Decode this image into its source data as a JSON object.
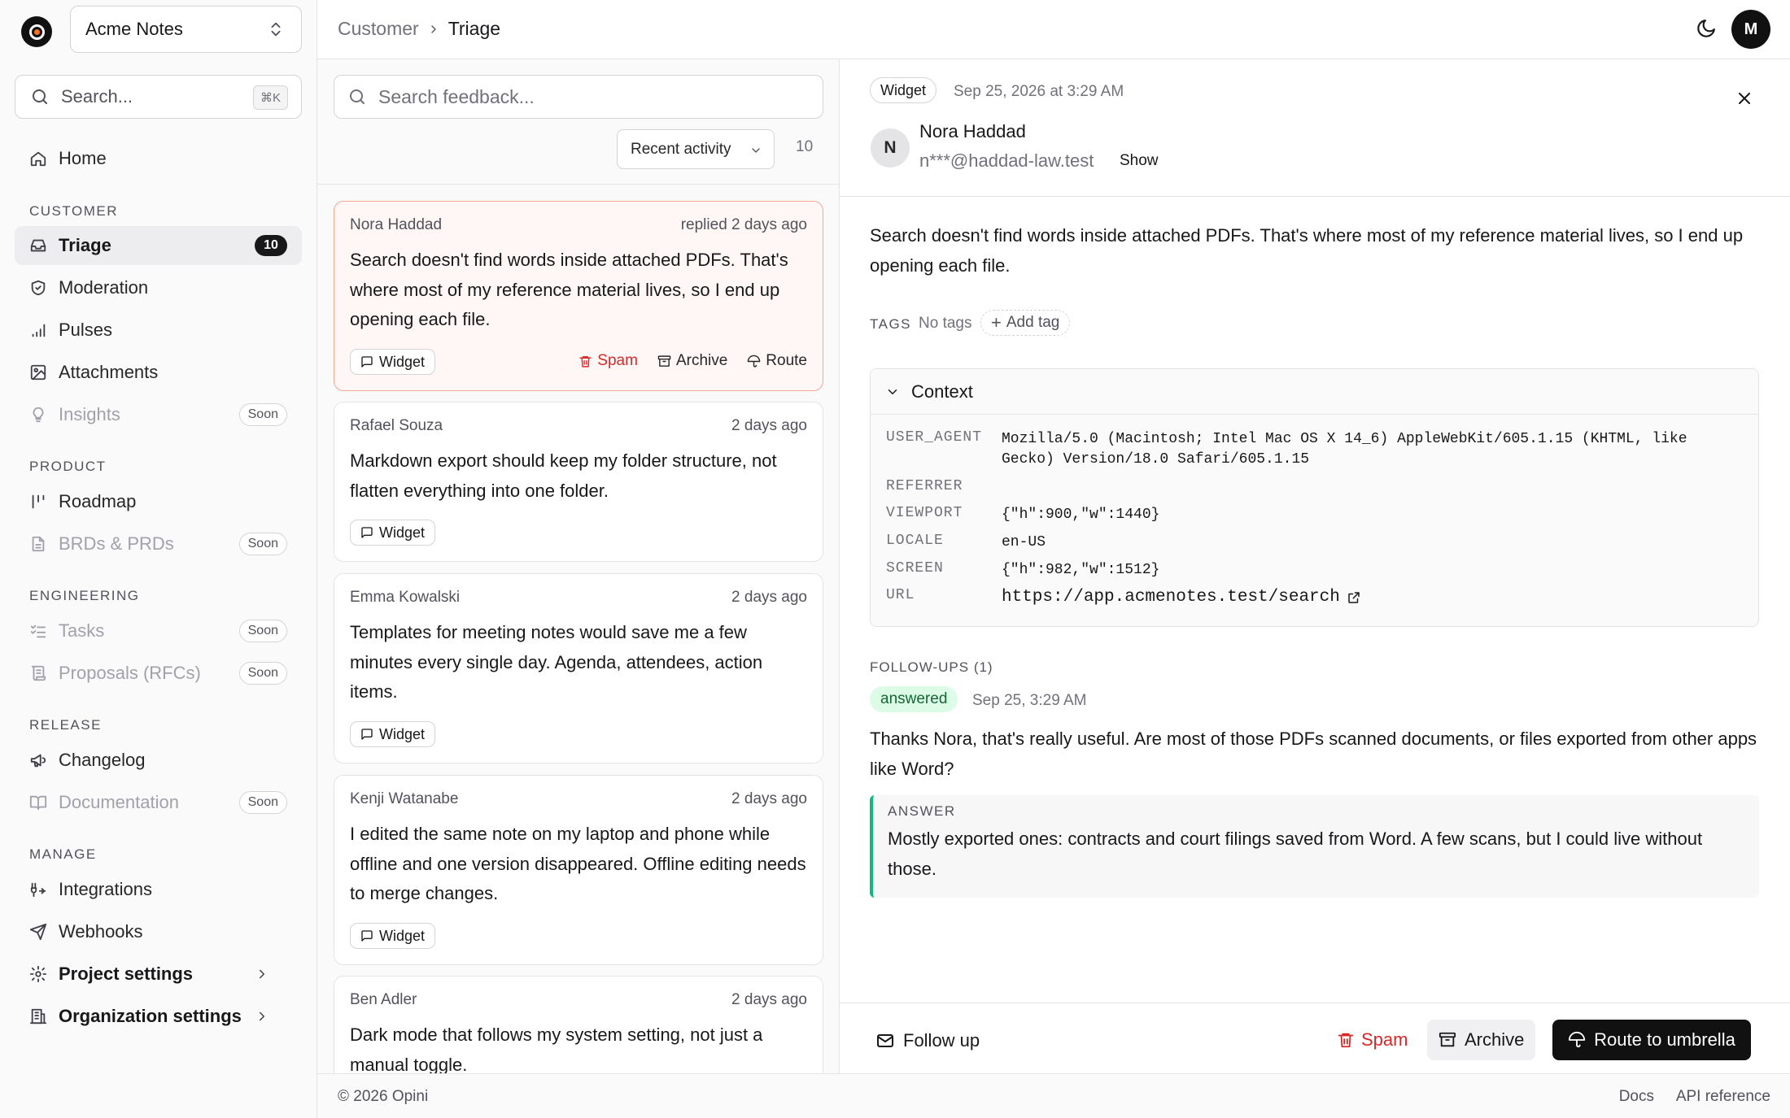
{
  "app": {
    "workspace": "Acme Notes"
  },
  "sidebar": {
    "search_placeholder": "Search...",
    "search_shortcut": "⌘K",
    "home": "Home",
    "sections": {
      "customer": "CUSTOMER",
      "product": "PRODUCT",
      "engineering": "ENGINEERING",
      "release": "RELEASE",
      "manage": "MANAGE"
    },
    "items": {
      "triage": {
        "label": "Triage",
        "count": "10"
      },
      "moderation": {
        "label": "Moderation"
      },
      "pulses": {
        "label": "Pulses"
      },
      "attachments": {
        "label": "Attachments"
      },
      "insights": {
        "label": "Insights",
        "badge": "Soon"
      },
      "roadmap": {
        "label": "Roadmap"
      },
      "brds": {
        "label": "BRDs & PRDs",
        "badge": "Soon"
      },
      "tasks": {
        "label": "Tasks",
        "badge": "Soon"
      },
      "proposals": {
        "label": "Proposals (RFCs)",
        "badge": "Soon"
      },
      "changelog": {
        "label": "Changelog"
      },
      "documentation": {
        "label": "Documentation",
        "badge": "Soon"
      },
      "integrations": {
        "label": "Integrations"
      },
      "webhooks": {
        "label": "Webhooks"
      },
      "project_settings": {
        "label": "Project settings"
      },
      "org_settings": {
        "label": "Organization settings"
      }
    }
  },
  "header": {
    "breadcrumb": [
      "Customer",
      "Triage"
    ],
    "avatar_initial": "M"
  },
  "list": {
    "search_placeholder": "Search feedback...",
    "sort": "Recent activity",
    "count": "10",
    "items": [
      {
        "author": "Nora Haddad",
        "time": "replied 2 days ago",
        "text": "Search doesn't find words inside attached PDFs. That's where most of my reference material lives, so I end up opening each file.",
        "source": "Widget",
        "actions": {
          "spam": "Spam",
          "archive": "Archive",
          "route": "Route"
        }
      },
      {
        "author": "Rafael Souza",
        "time": "2 days ago",
        "text": "Markdown export should keep my folder structure, not flatten everything into one folder.",
        "source": "Widget"
      },
      {
        "author": "Emma Kowalski",
        "time": "2 days ago",
        "text": "Templates for meeting notes would save me a few minutes every single day. Agenda, attendees, action items.",
        "source": "Widget"
      },
      {
        "author": "Kenji Watanabe",
        "time": "2 days ago",
        "text": "I edited the same note on my laptop and phone while offline and one version disappeared. Offline editing needs to merge changes.",
        "source": "Widget"
      },
      {
        "author": "Ben Adler",
        "time": "2 days ago",
        "text": "Dark mode that follows my system setting, not just a manual toggle."
      }
    ]
  },
  "detail": {
    "source": "Widget",
    "date": "Sep 25, 2026 at 3:29 AM",
    "avatar_initial": "N",
    "name": "Nora Haddad",
    "email": "n***@haddad-law.test",
    "show_label": "Show",
    "message": "Search doesn't find words inside attached PDFs. That's where most of my reference material lives, so I end up opening each file.",
    "tags_label": "TAGS",
    "tags_empty": "No tags",
    "add_tag": "Add tag",
    "context": {
      "title": "Context",
      "rows": [
        {
          "key": "USER_AGENT",
          "value": "Mozilla/5.0 (Macintosh; Intel Mac OS X 14_6) AppleWebKit/605.1.15 (KHTML, like Gecko) Version/18.0 Safari/605.1.15"
        },
        {
          "key": "REFERRER",
          "value": ""
        },
        {
          "key": "VIEWPORT",
          "value": "{\"h\":900,\"w\":1440}"
        },
        {
          "key": "LOCALE",
          "value": "en-US"
        },
        {
          "key": "SCREEN",
          "value": "{\"h\":982,\"w\":1512}"
        },
        {
          "key": "URL",
          "value": "https://app.acmenotes.test/search"
        }
      ]
    },
    "followups": {
      "label": "FOLLOW-UPS (1)",
      "status": "answered",
      "date": "Sep 25, 3:29 AM",
      "question": "Thanks Nora, that's really useful. Are most of those PDFs scanned documents, or files exported from other apps like Word?",
      "answer_label": "ANSWER",
      "answer": "Mostly exported ones: contracts and court filings saved from Word. A few scans, but I could live without those."
    },
    "footer": {
      "follow_up": "Follow up",
      "spam": "Spam",
      "archive": "Archive",
      "route": "Route to umbrella"
    }
  },
  "footer": {
    "copyright": "© 2026 Opini",
    "docs": "Docs",
    "api": "API reference"
  },
  "colors": {
    "accent_border": "#f2a793",
    "danger": "#dc2626",
    "success_bg": "#dcfce7",
    "answer_bar": "#10b981"
  }
}
